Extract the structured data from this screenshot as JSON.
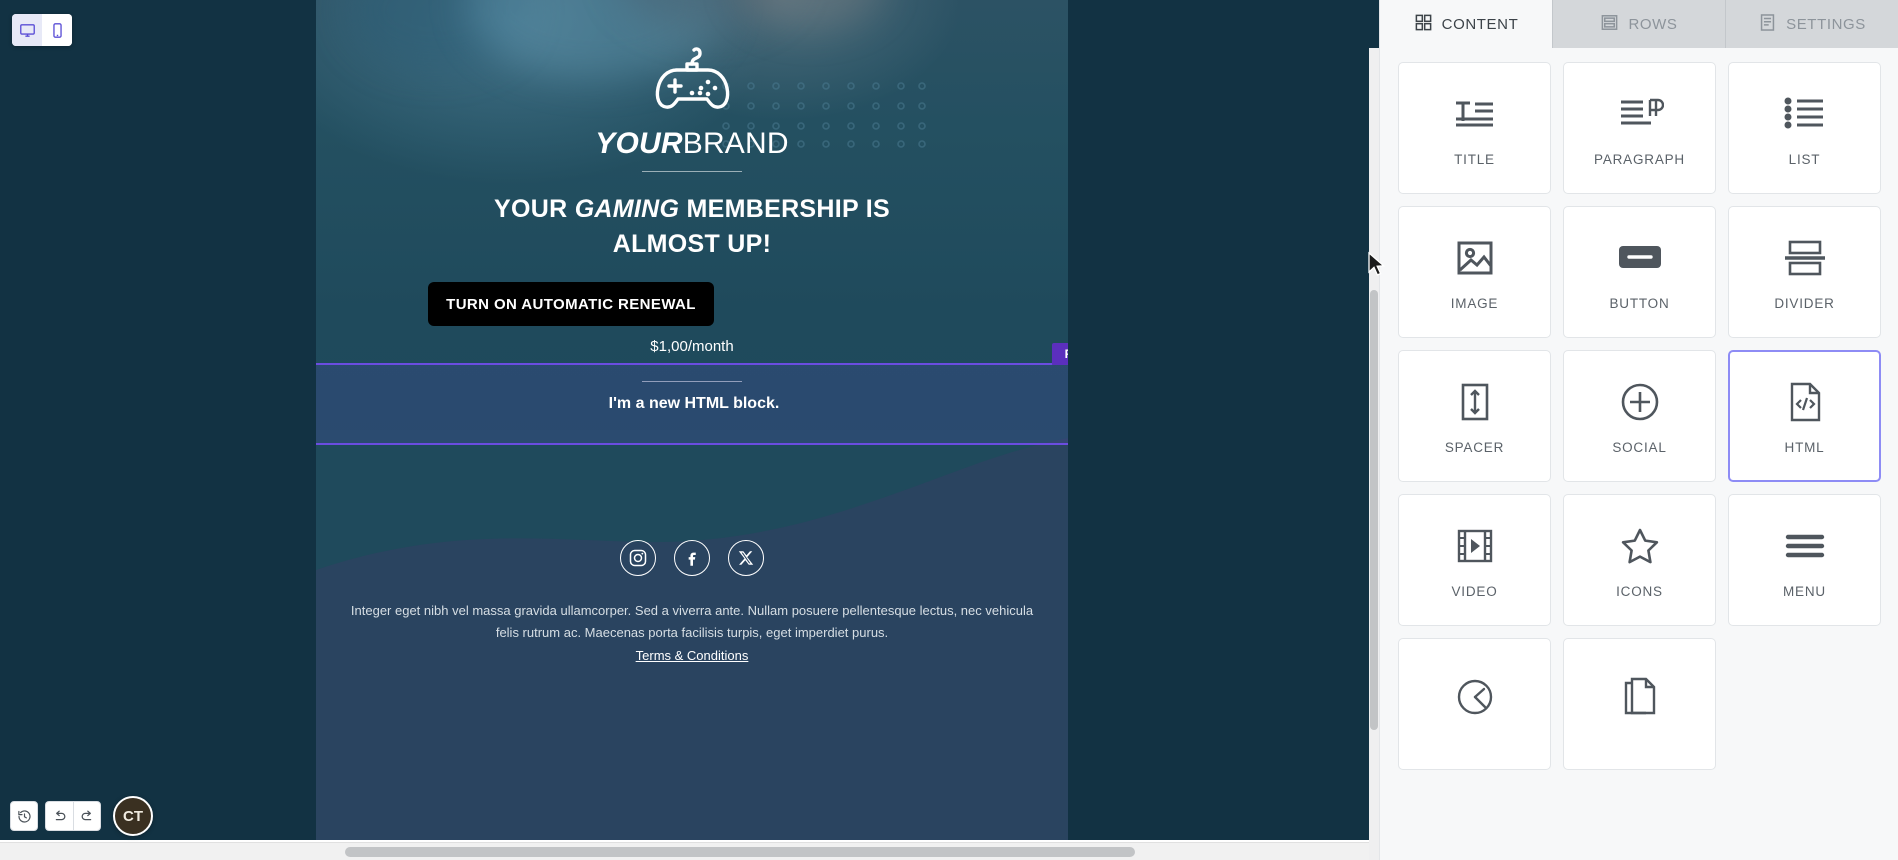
{
  "device_toggle": {
    "desktop_icon": "desktop-monitor-icon",
    "mobile_icon": "mobile-phone-icon",
    "active": "desktop"
  },
  "email": {
    "brand": {
      "bold_part": "YOUR",
      "light_part": "BRAND",
      "logo_icon": "gamepad-icon"
    },
    "headline_line1_a": "YOUR ",
    "headline_italic": "GAMING",
    "headline_line1_b": " MEMBERSHIP IS",
    "headline_line2": "ALMOST UP!",
    "cta_label": "TURN ON AUTOMATIC RENEWAL",
    "price": "$1,00/month",
    "html_block_text": "I'm a new HTML block.",
    "row_badge": "Row",
    "social": [
      {
        "name": "instagram-icon"
      },
      {
        "name": "facebook-icon"
      },
      {
        "name": "x-twitter-icon"
      }
    ],
    "footer_text": "Integer eget nibh vel massa gravida ullamcorper. Sed a viverra ante. Nullam posuere pellentesque lectus, nec vehicula felis rutrum ac. Maecenas porta facilisis turpis, eget imperdiet purus.",
    "terms_label": "Terms & Conditions"
  },
  "toolbar": {
    "history_icon": "history-clock-icon",
    "undo_icon": "undo-arrow-icon",
    "redo_icon": "redo-arrow-icon",
    "avatar_initials": "CT"
  },
  "panel": {
    "tabs": [
      {
        "label": "CONTENT",
        "icon": "grid-blocks-icon",
        "active": true
      },
      {
        "label": "ROWS",
        "icon": "rows-layout-icon",
        "active": false
      },
      {
        "label": "SETTINGS",
        "icon": "document-settings-icon",
        "active": false
      }
    ],
    "blocks": [
      {
        "label": "TITLE",
        "icon": "title-text-icon",
        "selected": false
      },
      {
        "label": "PARAGRAPH",
        "icon": "paragraph-icon",
        "selected": false
      },
      {
        "label": "LIST",
        "icon": "bullet-list-icon",
        "selected": false
      },
      {
        "label": "IMAGE",
        "icon": "image-icon",
        "selected": false
      },
      {
        "label": "BUTTON",
        "icon": "button-icon",
        "selected": false
      },
      {
        "label": "DIVIDER",
        "icon": "divider-icon",
        "selected": false
      },
      {
        "label": "SPACER",
        "icon": "spacer-icon",
        "selected": false
      },
      {
        "label": "SOCIAL",
        "icon": "social-plus-icon",
        "selected": false
      },
      {
        "label": "HTML",
        "icon": "html-code-icon",
        "selected": true
      },
      {
        "label": "VIDEO",
        "icon": "video-film-icon",
        "selected": false
      },
      {
        "label": "ICONS",
        "icon": "star-icon",
        "selected": false
      },
      {
        "label": "MENU",
        "icon": "hamburger-menu-icon",
        "selected": false
      },
      {
        "label": "",
        "icon": "gauge-meter-icon",
        "selected": false
      },
      {
        "label": "",
        "icon": "pages-stack-icon",
        "selected": false
      }
    ]
  },
  "colors": {
    "accent_purple": "#6b4de0",
    "row_badge_purple": "#5b2fbe",
    "selected_block_border": "#8e8cf5",
    "canvas_dark": "#123243",
    "hero_teal": "#1f4a5c"
  }
}
